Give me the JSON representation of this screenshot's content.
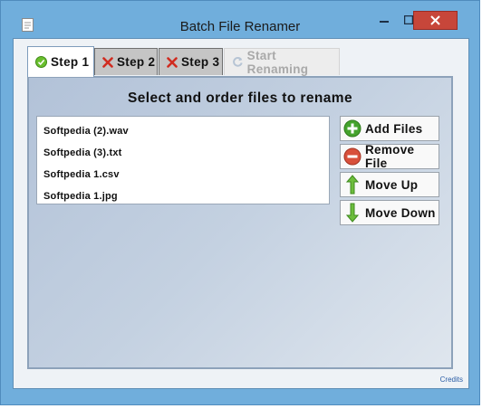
{
  "window": {
    "title": "Batch File Renamer",
    "icons": {
      "app": "notepad-icon",
      "minimize": "minimize-icon",
      "maximize": "maximize-icon",
      "close": "close-icon"
    }
  },
  "tabs": [
    {
      "label": "Step  1",
      "icon": "check-circle-icon",
      "state": "active"
    },
    {
      "label": "Step  2",
      "icon": "red-x-icon",
      "state": "inactive"
    },
    {
      "label": "Step  3",
      "icon": "red-x-icon",
      "state": "inactive"
    },
    {
      "label": "Start  Renaming",
      "icon": "refresh-icon",
      "state": "disabled"
    }
  ],
  "main": {
    "heading": "Select  and  order  files  to  rename",
    "files": [
      "Softpedia  (2).wav",
      "Softpedia  (3).txt",
      "Softpedia  1.csv",
      "Softpedia  1.jpg"
    ],
    "buttons": {
      "add": "Add  Files",
      "remove": "Remove  File",
      "up": "Move  Up",
      "down": "Move  Down"
    }
  },
  "footer": {
    "credits": "Credits"
  },
  "colors": {
    "frame": "#70aedc",
    "close_button": "#c7463a",
    "add_icon": "#45a32d",
    "remove_icon": "#d8503b",
    "arrow_icon": "#5aa832",
    "credits_link": "#2b5ea6"
  }
}
